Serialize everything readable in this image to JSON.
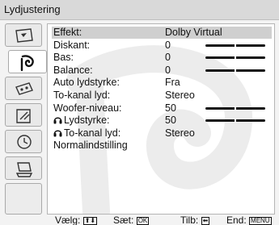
{
  "window": {
    "title": "Lydjustering"
  },
  "sidebar": {
    "icons": [
      {
        "icon": "picture-settings-icon"
      },
      {
        "icon": "sound-settings-icon",
        "active": true
      },
      {
        "icon": "features-icon"
      },
      {
        "icon": "setup-icon"
      },
      {
        "icon": "timer-icon"
      },
      {
        "icon": "pc-settings-icon"
      }
    ]
  },
  "settings": [
    {
      "label": "Effekt:",
      "value": "Dolby Virtual",
      "selected": true
    },
    {
      "label": "Diskant:",
      "value": "0",
      "level": 0.5
    },
    {
      "label": "Bas:",
      "value": "0",
      "level": 0.5
    },
    {
      "label": "Balance:",
      "value": "0",
      "level": 0.5
    },
    {
      "label": "Auto lydstyrke:",
      "value": "Fra"
    },
    {
      "label": "To-kanal lyd:",
      "value": "Stereo"
    },
    {
      "label": "Woofer-niveau:",
      "value": "50",
      "level": 0.5
    },
    {
      "label": "Lydstyrke:",
      "value": "50",
      "level": 0.5,
      "headphone": true
    },
    {
      "label": "To-kanal lyd:",
      "value": "Stereo",
      "headphone": true
    },
    {
      "label": "Normalindstilling",
      "value": ""
    }
  ],
  "footer": {
    "select_label": "Vælg:",
    "select_keys": "⬆⬇",
    "set_label": "Sæt:",
    "set_key": "OK",
    "back_label": "Tilb:",
    "back_key": "⬅",
    "end_label": "End:",
    "end_key": "MENU"
  },
  "colors": {
    "selected_row": "#cfcfcf",
    "watermark": "#e6e6e6"
  }
}
